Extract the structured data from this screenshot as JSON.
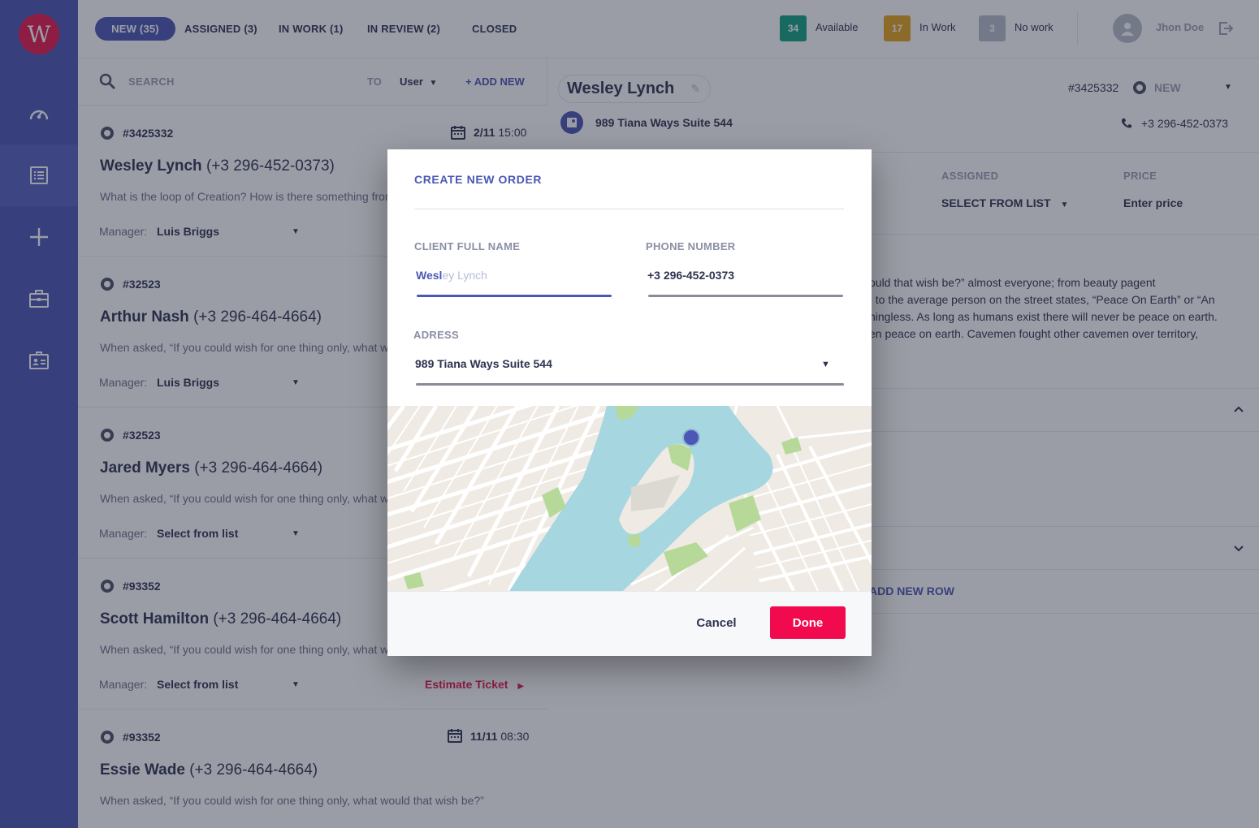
{
  "app": {
    "logo_letter": "W"
  },
  "tabs": [
    {
      "label": "NEW (35)",
      "active": true
    },
    {
      "label": "ASSIGNED (3)"
    },
    {
      "label": "IN WORK (1)"
    },
    {
      "label": "IN REVIEW (2)"
    },
    {
      "label": "CLOSED"
    }
  ],
  "statuses": [
    {
      "count": "34",
      "label": "Available",
      "color": "#12a381"
    },
    {
      "count": "17",
      "label": "In Work",
      "color": "#e3a21a"
    },
    {
      "count": "3",
      "label": "No work",
      "color": "#b9bdcc"
    }
  ],
  "user": {
    "name": "Jhon Doe"
  },
  "list": {
    "search_placeholder": "SEARCH",
    "to_label": "TO",
    "to_value": "User",
    "add_new": "+ ADD NEW",
    "manager_label": "Manager:",
    "estimate_label": "Estimate Ticket",
    "orders": [
      {
        "id": "#3425332",
        "name": "Wesley Lynch",
        "phone": "(+3 296-452-0373)",
        "desc": "What is the loop of Creation? How is there something from nothing?",
        "manager": "Luis Briggs",
        "date": "2/11",
        "time": "15:00"
      },
      {
        "id": "#32523",
        "name": "Arthur Nash",
        "phone": "(+3 296-464-4664)",
        "desc": "When asked, “If you could wish for one thing only, what would that wish be?”",
        "manager": "Luis Briggs"
      },
      {
        "id": "#32523",
        "name": "Jared Myers",
        "phone": "(+3 296-464-4664)",
        "desc": "When asked, “If you could wish for one thing only, what would that wish be?”",
        "manager": "Select from list"
      },
      {
        "id": "#93352",
        "name": "Scott Hamilton",
        "phone": "(+3 296-464-4664)",
        "desc": "When asked, “If you could wish for one thing only, what would that wish be?”",
        "manager": "Select from list"
      },
      {
        "id": "#93352",
        "name": "Essie Wade",
        "phone": "(+3 296-464-4664)",
        "desc": "When asked, “If you could wish for one thing only, what would that wish be?”",
        "date": "11/11",
        "time": "08:30"
      }
    ]
  },
  "detail": {
    "name": "Wesley Lynch",
    "id": "#3425332",
    "status": "NEW",
    "address": "989 Tiana Ways Suite 544",
    "phone": "+3 296-452-0373",
    "assigned_label": "ASSIGNED",
    "assigned_value": "SELECT FROM LIST",
    "price_label": "PRICE",
    "price_value": "Enter price",
    "desc_lines": [
      "ould that wish be?” almost everyone; from beauty pagent",
      ", to the average person on the street states, “Peace On Earth” or “An",
      "hingless. As long as humans exist there will never be peace on earth.",
      "en peace on earth. Cavemen fought other cavemen over territory,"
    ],
    "add_row": "ADD NEW ROW"
  },
  "modal": {
    "title": "CREATE NEW ORDER",
    "client_label": "CLIENT FULL NAME",
    "client_typed": "Wesl",
    "client_suggest": "ey Lynch",
    "phone_label": "PHONE NUMBER",
    "phone_value": "+3 296-452-0373",
    "address_label": "ADRESS",
    "address_value": "989 Tiana Ways Suite 544",
    "cancel": "Cancel",
    "done": "Done"
  }
}
